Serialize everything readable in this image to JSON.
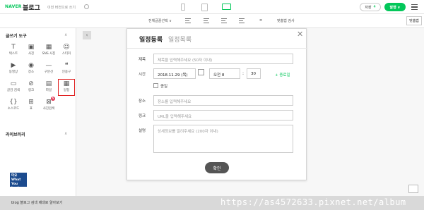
{
  "header": {
    "logo": "NAVER",
    "title": "블로그",
    "prev_version": "이전 버전으로 쓰기",
    "save_label": "저장",
    "save_count": "4",
    "publish_label": "발행 ∨"
  },
  "format_bar": {
    "font_select": "전체글꼴선택 ∨",
    "spellcheck_short": "맞춤법 검사",
    "spellcheck_button": "맞춤법"
  },
  "sidebar": {
    "tools_heading": "글쓰기 도구",
    "tools": [
      {
        "icon": "T",
        "label": "텍스트"
      },
      {
        "icon": "▣",
        "label": "사진"
      },
      {
        "icon": "▦",
        "label": "SNS 사진"
      },
      {
        "icon": "☺",
        "label": "스티커"
      },
      {
        "icon": "▶",
        "label": "동영상"
      },
      {
        "icon": "◉",
        "label": "장소"
      },
      {
        "icon": "—",
        "label": "구분선"
      },
      {
        "icon": "❝",
        "label": "인용구"
      },
      {
        "icon": "▭",
        "label": "글감 검색"
      },
      {
        "icon": "⊘",
        "label": "링크"
      },
      {
        "icon": "▤",
        "label": "파일"
      },
      {
        "icon": "▦",
        "label": "일정"
      },
      {
        "icon": "{}",
        "label": "소스코드"
      },
      {
        "icon": "⊞",
        "label": "표"
      },
      {
        "icon": "⊠",
        "label": "사진검색"
      }
    ],
    "badge": "N",
    "library_heading": "라이브러리",
    "library_thumb": "마요 What You Look"
  },
  "modal": {
    "tab_active": "일정등록",
    "tab_inactive": "일정목록",
    "close": "✕",
    "title_label": "제목",
    "title_placeholder": "제목을 입력해주세요 (50자 이내)",
    "time_label": "시간",
    "date_value": "2018.11.29 (목)",
    "ampm_value": "오전 8",
    "minute_value": "30",
    "add_time": "+ 종료일",
    "allday_label": "종일",
    "place_label": "장소",
    "place_placeholder": "장소를 입력해주세요",
    "link_label": "링크",
    "link_placeholder": "URL을 입력해주세요",
    "desc_label": "설명",
    "desc_placeholder": "상세정보를 알려주세요 (200자 이내)",
    "ok_label": "확인"
  },
  "bottom": {
    "text": "blog 블로그 검색 제대로 알아보기",
    "watermark": "https://as4572633.pixnet.net/album"
  }
}
